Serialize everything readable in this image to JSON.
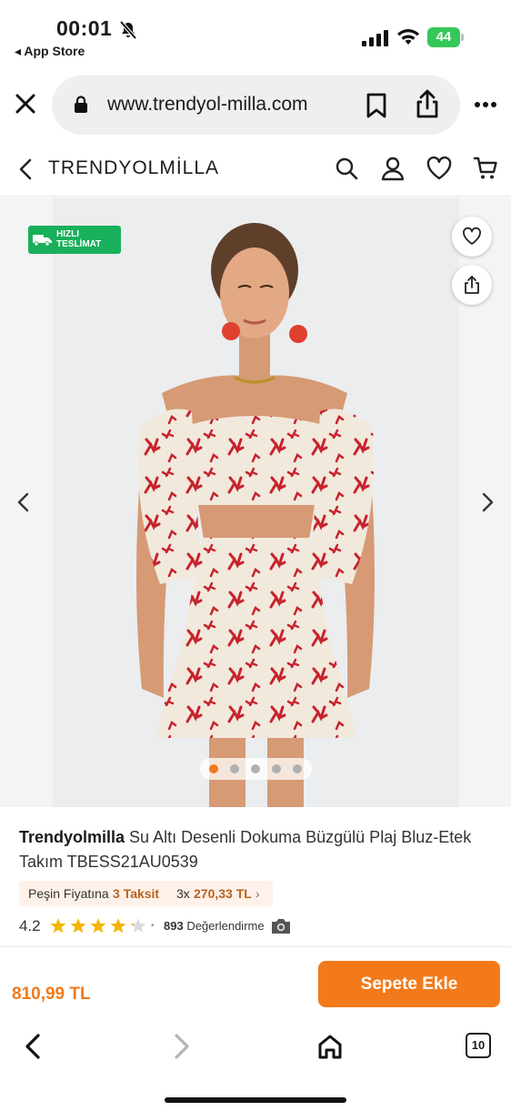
{
  "status_bar": {
    "time": "00:01",
    "back_app": "◂ App Store",
    "battery": "44"
  },
  "browser": {
    "url": "www.trendyol-milla.com"
  },
  "site_header": {
    "brand": "TRENDYOLMİLLA"
  },
  "gallery": {
    "badge_line1": "HIZLI",
    "badge_line2": "TESLİMAT",
    "image_count": 5,
    "active_index": 0
  },
  "product": {
    "brand": "Trendyolmilla",
    "name": " Su Altı Desenli Dokuma Büzgülü Plaj Bluz-Etek Takım TBESS21AU0539",
    "installment": {
      "prefix": "Peşin Fiyatına",
      "taksit": "3 Taksit",
      "bullet": "•",
      "multiplier": "3x",
      "amount": "270,33 TL",
      "chevron": "›"
    },
    "rating": "4.2",
    "rating_value": 4.2,
    "rating_sep": "•",
    "review_count": "893",
    "review_label": " Değerlendirme"
  },
  "purchase": {
    "price": "810,99 TL",
    "add_to_cart": "Sepete Ekle"
  },
  "safari_bar": {
    "tab_count": "10"
  },
  "colors": {
    "accent": "#f27a1a",
    "badge_green": "#18b05a",
    "battery_green": "#35c759",
    "star_yellow": "#f5b400",
    "installment_bg": "#fdf1ea",
    "installment_text": "#b9621d"
  },
  "icons": [
    "bell-slash-icon",
    "signal-icon",
    "wifi-icon",
    "battery-icon",
    "close-icon",
    "lock-icon",
    "bookmark-icon",
    "share-icon",
    "more-icon",
    "chevron-left-icon",
    "search-icon",
    "user-icon",
    "heart-icon",
    "cart-icon",
    "truck-icon",
    "star-icon",
    "camera-icon",
    "home-icon",
    "tabs-icon"
  ]
}
